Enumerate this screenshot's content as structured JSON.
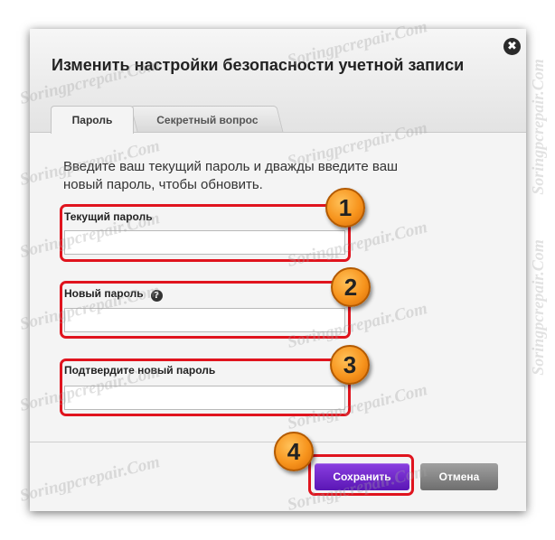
{
  "dialog": {
    "title": "Изменить настройки безопасности учетной записи",
    "close_glyph": "✖",
    "tabs": [
      {
        "label": "Пароль",
        "active": true
      },
      {
        "label": "Секретный вопрос",
        "active": false
      }
    ],
    "instructions": "Введите ваш текущий пароль и дважды введите ваш новый пароль, чтобы обновить.",
    "fields": [
      {
        "label": "Текущий пароль",
        "value": ""
      },
      {
        "label": "Новый пароль",
        "value": "",
        "help_glyph": "?"
      },
      {
        "label": "Подтвердите новый пароль",
        "value": ""
      }
    ],
    "buttons": {
      "save": "Сохранить",
      "cancel": "Отмена"
    }
  },
  "annotations": {
    "badges": [
      "1",
      "2",
      "3",
      "4"
    ],
    "highlight_color": "#e0141e",
    "badge_color": "#f7941d"
  },
  "watermark": {
    "text": "Soringpcrepair.Com"
  },
  "colors": {
    "save_button": "#6a22c9",
    "cancel_button": "#8a8a8a"
  }
}
